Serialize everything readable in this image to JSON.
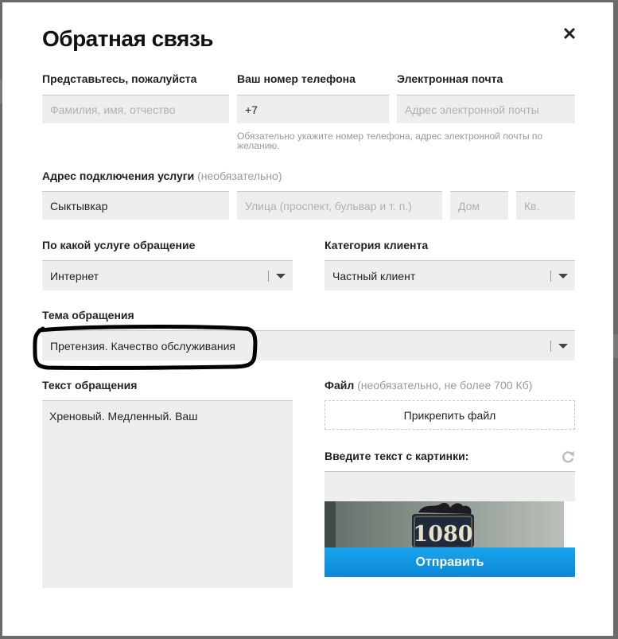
{
  "dialog": {
    "title": "Обратная связь"
  },
  "contact": {
    "name_label": "Представьтесь, пожалуйста",
    "name_placeholder": "Фамилия, имя, отчество",
    "phone_label": "Ваш номер телефона",
    "phone_value": "+7",
    "email_label": "Электронная почта",
    "email_placeholder": "Адрес электронной почты",
    "hint": "Обязательно укажите номер телефона, адрес электронной почты по желанию."
  },
  "address": {
    "label": "Адрес подключения услуги",
    "optional": "(необязательно)",
    "city_value": "Сыктывкар",
    "street_placeholder": "Улица (проспект, бульвар и т. п.)",
    "house_placeholder": "Дом",
    "apt_placeholder": "Кв."
  },
  "service": {
    "label": "По какой услуге обращение",
    "selected": "Интернет"
  },
  "client_category": {
    "label": "Категория клиента",
    "selected": "Частный клиент"
  },
  "topic": {
    "label": "Тема обращения",
    "selected": "Претензия. Качество обслуживания"
  },
  "message": {
    "label": "Текст обращения",
    "value": "Хреновый. Медленный. Ваш"
  },
  "file": {
    "label": "Файл",
    "note": "(необязательно, не более 700 Кб)",
    "attach_label": "Прикрепить файл"
  },
  "captcha": {
    "label": "Введите текст с картинки:",
    "image_text": "1080",
    "input_value": ""
  },
  "submit_label": "Отправить",
  "icons": {
    "close": "close-icon",
    "dropdown": "chevron-down-icon",
    "refresh": "refresh-icon"
  },
  "colors": {
    "accent": "#0b93e0",
    "field_bg": "#eeeeee"
  }
}
